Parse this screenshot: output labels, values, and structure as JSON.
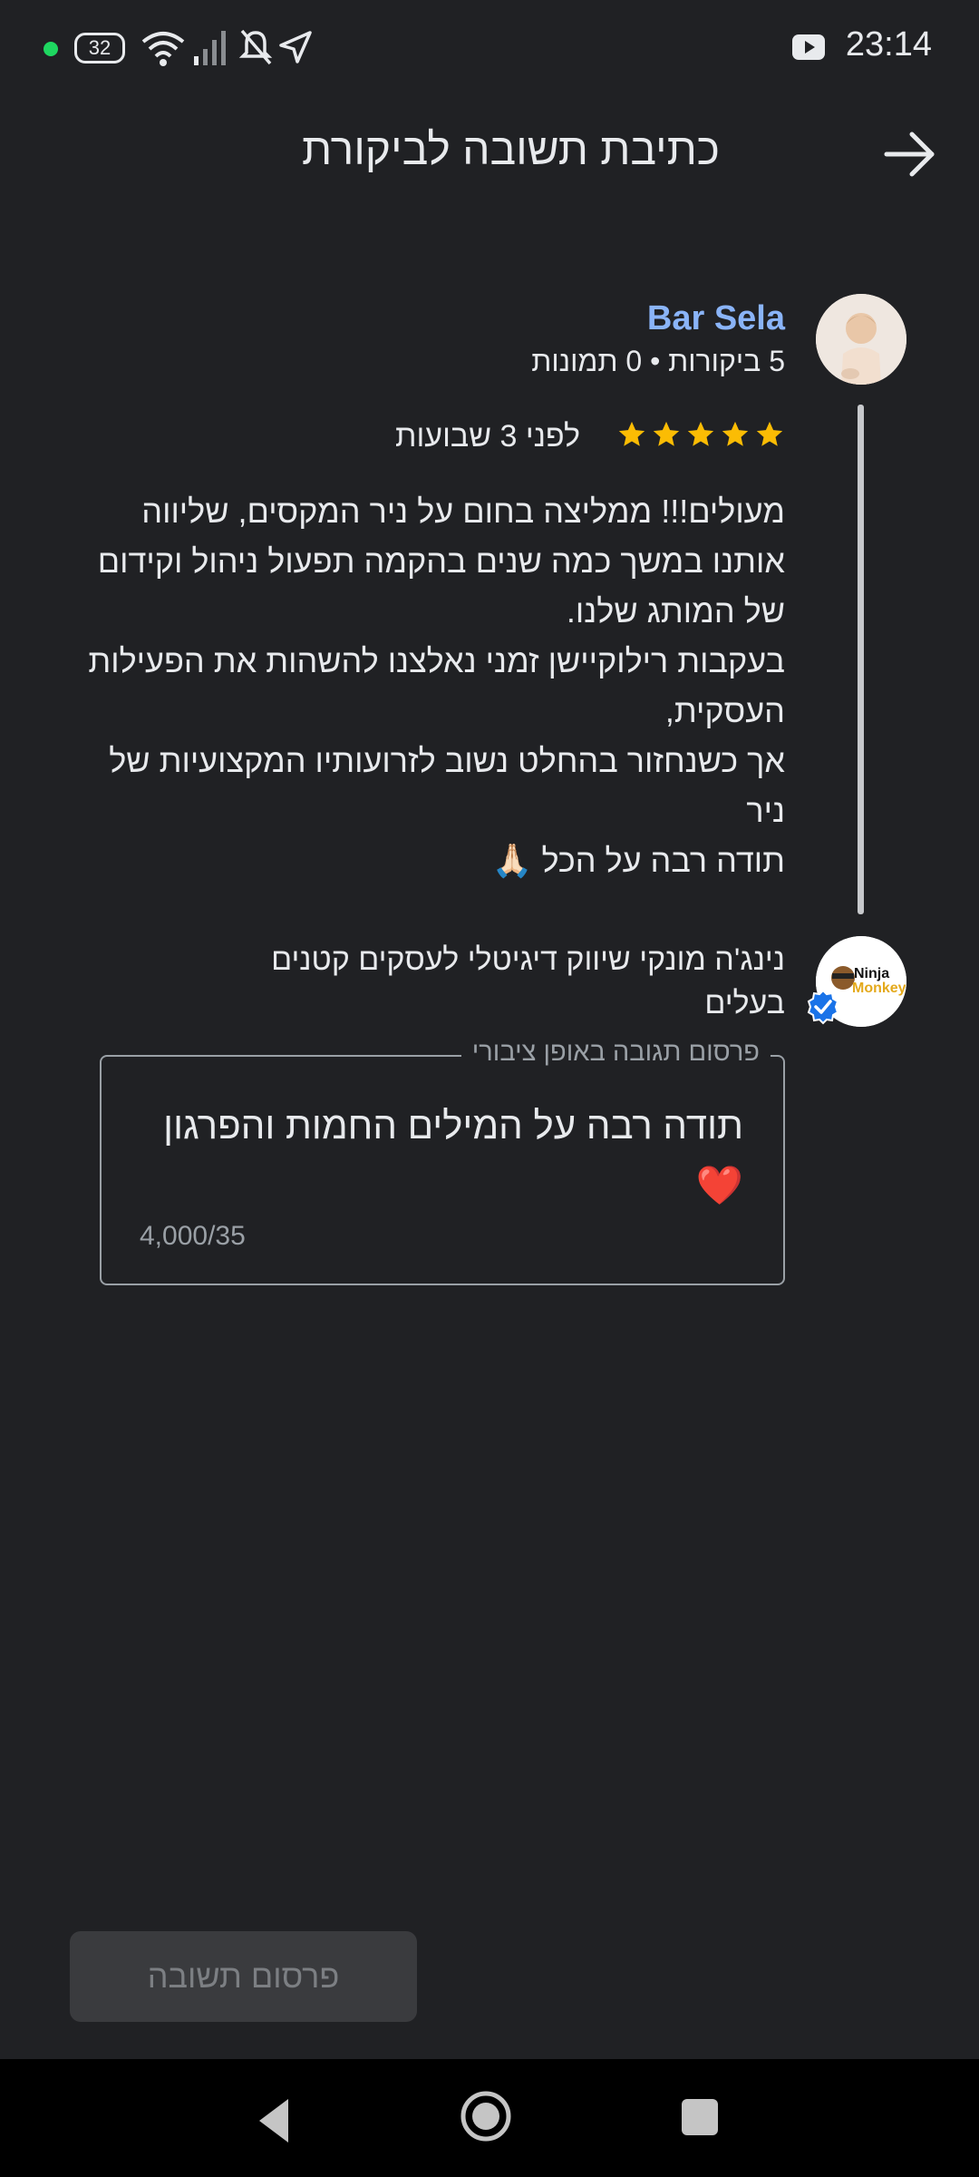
{
  "status_bar": {
    "time": "23:14",
    "battery": "32"
  },
  "header": {
    "title": "כתיבת תשובה לביקורת"
  },
  "review": {
    "reviewer_name": "Bar Sela",
    "reviewer_meta": "5 ביקורות • 0 תמונות",
    "rating": 5,
    "time_ago": "לפני 3 שבועות",
    "text": "מעולים!!! ממליצה בחום על ניר המקסים, שליווה אותנו במשך כמה שנים בהקמה תפעול ניהול וקידום של המותג שלנו.\nבעקבות רילוקיישן זמני נאלצנו להשהות את הפעילות העסקית,\nאך כשנחזור בהחלט נשוב לזרועותיו המקצועיות של ניר\nתודה רבה על הכל 🙏🏻"
  },
  "owner": {
    "name": "נינג'ה מונקי שיווק דיגיטלי לעסקים קטנים",
    "role": "בעלים",
    "logo_text_1": "Ninja",
    "logo_text_2": "Monkey"
  },
  "reply": {
    "legend": "פרסום תגובה באופן ציבורי",
    "text": "תודה רבה על המילים החמות והפרגון ❤️",
    "char_count": "4,000/35"
  },
  "actions": {
    "publish_label": "פרסום תשובה"
  },
  "colors": {
    "background": "#202124",
    "accent_name": "#8ab4f8",
    "star": "#fbbc04",
    "verified": "#1a73e8"
  }
}
